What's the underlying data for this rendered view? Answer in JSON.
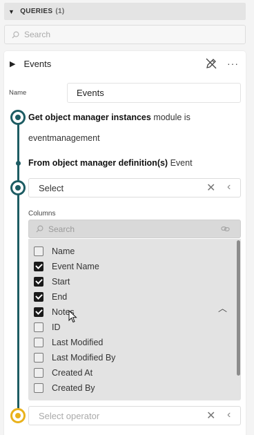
{
  "header": {
    "title": "QUERIES",
    "count": "(1)"
  },
  "top_search": {
    "placeholder": "Search"
  },
  "query": {
    "title": "Events",
    "name_label": "Name",
    "name_value": "Events",
    "step1_bold": "Get object manager instances",
    "step1_rest": " module is",
    "step1_line2": "eventmanagement",
    "step2_bold": "From object manager definition(s)",
    "step2_rest": " Event",
    "select_value": "Select",
    "columns_label": "Columns",
    "columns_search_placeholder": "Search",
    "columns": [
      {
        "label": "Name",
        "checked": false
      },
      {
        "label": "Event Name",
        "checked": true
      },
      {
        "label": "Start",
        "checked": true
      },
      {
        "label": "End",
        "checked": true
      },
      {
        "label": "Notes",
        "checked": true
      },
      {
        "label": "ID",
        "checked": false
      },
      {
        "label": "Last Modified",
        "checked": false
      },
      {
        "label": "Last Modified By",
        "checked": false
      },
      {
        "label": "Created At",
        "checked": false
      },
      {
        "label": "Created By",
        "checked": false
      }
    ],
    "operator_placeholder": "Select operator",
    "more_label": "···"
  },
  "colors": {
    "timeline": "#1d5c63",
    "pending_node": "#e9b21c"
  }
}
